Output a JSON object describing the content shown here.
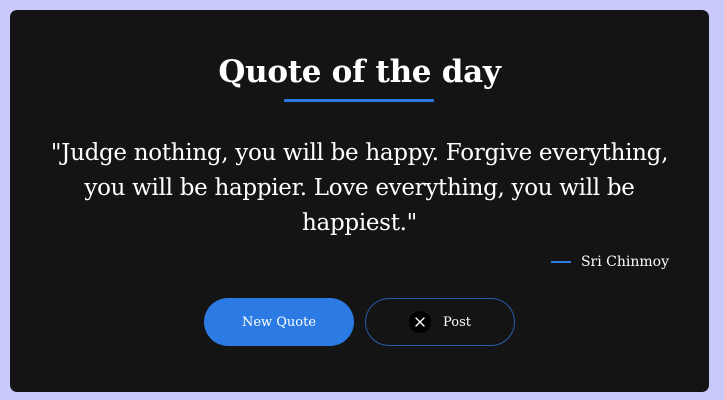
{
  "card": {
    "title": "Quote of the day",
    "quote": "\"Judge nothing, you will be happy. Forgive everything, you will be happier. Love everything, you will be happiest.\"",
    "author": "Sri Chinmoy"
  },
  "buttons": {
    "new_quote_label": "New Quote",
    "post_label": "Post",
    "post_icon": "x-logo-icon"
  },
  "colors": {
    "page_background": "#c9c9fb",
    "card_background": "#141414",
    "accent": "#2c7be5",
    "text": "#ffffff"
  }
}
